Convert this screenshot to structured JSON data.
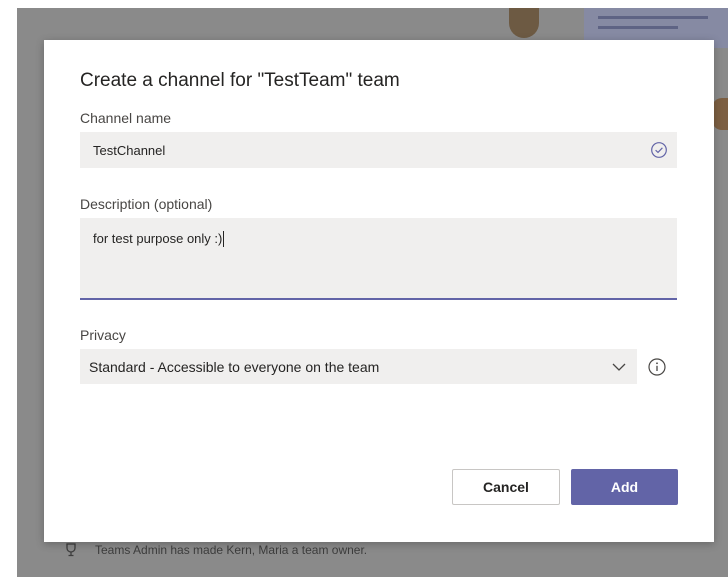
{
  "background": {
    "activity_text": "Teams Admin has made Kern, Maria a team owner."
  },
  "dialog": {
    "title": "Create a channel for \"TestTeam\" team",
    "channel_name": {
      "label": "Channel name",
      "value": "TestChannel",
      "icon": "check-circle-icon"
    },
    "description": {
      "label": "Description (optional)",
      "value": "for test purpose only :)"
    },
    "privacy": {
      "label": "Privacy",
      "selected": "Standard - Accessible to everyone on the team",
      "icon": "chevron-down-icon",
      "info_icon": "info-icon"
    },
    "buttons": {
      "cancel": "Cancel",
      "add": "Add"
    }
  },
  "colors": {
    "accent": "#6264a7",
    "input_bg": "#f0efee",
    "overlay": "#8a8a8a"
  }
}
